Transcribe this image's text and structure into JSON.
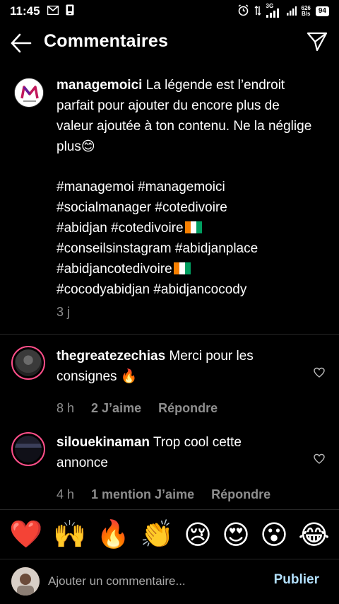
{
  "status_bar": {
    "time": "11:45",
    "network_type": "3G",
    "net_speed_value": "626",
    "net_speed_unit": "B/s",
    "battery": "94"
  },
  "header": {
    "title": "Commentaires"
  },
  "caption": {
    "username": "managemoici",
    "text": "La légende est l’endroit parfait pour ajouter du encore plus de valeur ajoutée à ton contenu. Ne la néglige plus😊",
    "hashtag_lines": [
      "#managemoi #managemoici",
      "#socialmanager #cotedivoire",
      "#abidjan #cotedivoire",
      "#conseilsinstagram #abidjanplace",
      "#abidjancotedivoire",
      "#cocodyabidjan #abidjancocody"
    ],
    "time": "3 j"
  },
  "comments": [
    {
      "username": "thegreatezechias",
      "text": "Merci pour les consignes 🔥",
      "time": "8 h",
      "likes": "2 J’aime",
      "reply": "Répondre"
    },
    {
      "username": "silouekinaman",
      "text": "Trop cool cette annonce",
      "time": "4 h",
      "likes": "1 mention J’aime",
      "reply": "Répondre"
    }
  ],
  "emoji_bar": [
    "❤️",
    "🙌",
    "🔥",
    "👏",
    "😢",
    "😍",
    "😮",
    "😂"
  ],
  "input": {
    "placeholder": "Ajouter un commentaire...",
    "publish_label": "Publier"
  },
  "colors": {
    "background": "#000000",
    "secondary_text": "#8e8e8e",
    "publish": "#b2dffc",
    "story_ring": "#ff4f8a"
  }
}
